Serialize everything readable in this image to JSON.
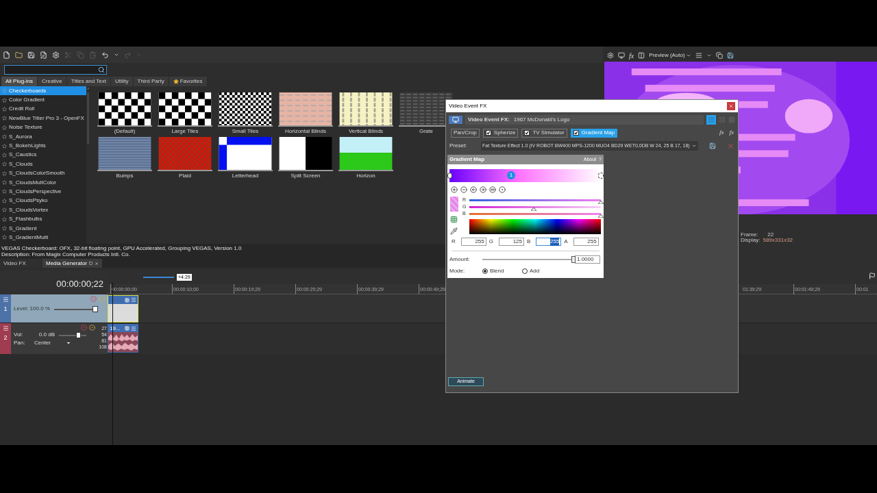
{
  "toolbar": [
    {
      "kind": "new",
      "disabled": false
    },
    {
      "kind": "open",
      "disabled": false
    },
    {
      "kind": "save",
      "disabled": false
    },
    {
      "kind": "save-as",
      "disabled": false
    },
    {
      "kind": "properties",
      "disabled": false
    },
    {
      "kind": "cut",
      "disabled": true
    },
    {
      "kind": "copy",
      "disabled": true
    },
    {
      "kind": "paste",
      "disabled": true
    },
    {
      "kind": "undo",
      "disabled": false
    },
    {
      "kind": "menu",
      "disabled": false
    },
    {
      "kind": "redo",
      "disabled": true
    },
    {
      "kind": "menu",
      "disabled": true
    }
  ],
  "plugin_browser": {
    "tabs": [
      {
        "label": "All Plug-ins",
        "selected": true
      },
      {
        "label": "Creative",
        "selected": false
      },
      {
        "label": "Titles and Text",
        "selected": false
      },
      {
        "label": "Utility",
        "selected": false
      },
      {
        "label": "Third Party",
        "selected": false
      },
      {
        "label": "Favorites",
        "selected": false
      }
    ],
    "plugins": [
      {
        "label": "Checkerboards",
        "selected": true
      },
      {
        "label": "Color Gradient",
        "selected": false
      },
      {
        "label": "Credit Roll",
        "selected": false
      },
      {
        "label": "NewBlue Titler Pro 3 - OpenFX",
        "selected": false
      },
      {
        "label": "Noise Texture",
        "selected": false
      },
      {
        "label": "S_Aurora",
        "selected": false
      },
      {
        "label": "S_BokehLights",
        "selected": false
      },
      {
        "label": "S_Caustics",
        "selected": false
      },
      {
        "label": "S_Clouds",
        "selected": false
      },
      {
        "label": "S_CloudsColorSmooth",
        "selected": false
      },
      {
        "label": "S_CloudsMultColor",
        "selected": false
      },
      {
        "label": "S_CloudsPerspective",
        "selected": false
      },
      {
        "label": "S_CloudsPsyko",
        "selected": false
      },
      {
        "label": "S_CloudsVortex",
        "selected": false
      },
      {
        "label": "S_Flashbulbs",
        "selected": false
      },
      {
        "label": "S_Gradient",
        "selected": false
      },
      {
        "label": "S_GradientMulti",
        "selected": false
      }
    ],
    "presets": [
      {
        "label": "(Default)",
        "kind": "checker"
      },
      {
        "label": "Large Tiles",
        "kind": "checker-large"
      },
      {
        "label": "Small Tiles",
        "kind": "checker-small"
      },
      {
        "label": "Horizontal Blinds",
        "kind": "hblinds"
      },
      {
        "label": "Vertical Blinds",
        "kind": "vblinds"
      },
      {
        "label": "Grate",
        "kind": "grate"
      },
      {
        "label": "Bumps",
        "kind": "bumps"
      },
      {
        "label": "Plaid",
        "kind": "plaid"
      },
      {
        "label": "Letterhead",
        "kind": "letterhead"
      },
      {
        "label": "Split Screen",
        "kind": "split"
      },
      {
        "label": "Horizon",
        "kind": "horizon"
      }
    ],
    "info": [
      "VEGAS Checkerboard: OFX, 32-bit floating point, GPU Accelerated, Grouping VEGAS, Version 1.0",
      "Description: From Magix Computer Products Intl. Co."
    ],
    "dock_tabs": [
      {
        "label": "Video FX",
        "selected": false
      },
      {
        "label": "Media Generator",
        "selected": true
      }
    ]
  },
  "preview": {
    "fx": "fx",
    "mode": "Preview (Auto)",
    "frame_label": "Frame:",
    "frame": "22",
    "display_label": "Display:",
    "display": "589x331x32"
  },
  "timeline": {
    "time": "00:00:00;22",
    "marker": "+4:29",
    "ruler_left": [
      "00:00:00;00",
      "00:00:10;00",
      "00:00:19;29",
      "00:00:29;29",
      "00:00:39;29",
      "00:00:49;29"
    ],
    "ruler_right": [
      "01:39;29",
      "00:01:49;29",
      "00:01"
    ],
    "tracks": [
      {
        "kind": "video",
        "number": "1",
        "level_label": "Level: 100.0 %",
        "level": 1
      },
      {
        "kind": "audio",
        "number": "2",
        "vol_label": "Vol:",
        "vol": "0.0 dB",
        "pan_label": "Pan:",
        "pan": "Center",
        "meter": [
          "27",
          "54",
          "81",
          "108"
        ],
        "clip": "19...",
        "level": 0.7
      }
    ]
  },
  "dialog": {
    "title": "Video Event FX",
    "header_label": "Video Event FX:",
    "header_value": "1967 McDonald's Logo",
    "fx_add": "fx",
    "fx_remove": "fx",
    "chain": [
      {
        "label": "Pan/Crop",
        "kind": "plain",
        "selected": false
      },
      {
        "label": "Spherize",
        "kind": "toggle",
        "checked": true,
        "selected": false
      },
      {
        "label": "TV Simulator",
        "kind": "toggle",
        "checked": true,
        "selected": false
      },
      {
        "label": "Gradient Map",
        "kind": "toggle",
        "checked": true,
        "selected": true
      }
    ],
    "preset_label": "Preset:",
    "preset": "Fat Texture Effect 1.0 (IV ROBOT BW400 MPS-1200 MUO4 BD29 WET0,0DB W 24, 25 B 17, 18)",
    "panel": {
      "title": "Gradient Map",
      "about": "About",
      "help": "?",
      "stop": "1",
      "channels": [
        {
          "label": "R",
          "level": 1
        },
        {
          "label": "G",
          "level": 0.49
        },
        {
          "label": "B",
          "level": 1
        }
      ],
      "fields": [
        {
          "label": "R",
          "value": "255",
          "selected": false
        },
        {
          "label": "G",
          "value": "125",
          "selected": false
        },
        {
          "label": "B",
          "value": "255",
          "selected": true
        },
        {
          "label": "A",
          "value": "255",
          "selected": false
        }
      ],
      "amount_label": "Amount:",
      "amount": {
        "level": 1,
        "value": "1.0000"
      },
      "mode_label": "Mode:",
      "modes": [
        {
          "label": "Blend",
          "selected": true
        },
        {
          "label": "Add",
          "selected": false
        }
      ]
    },
    "button": "Animate"
  }
}
